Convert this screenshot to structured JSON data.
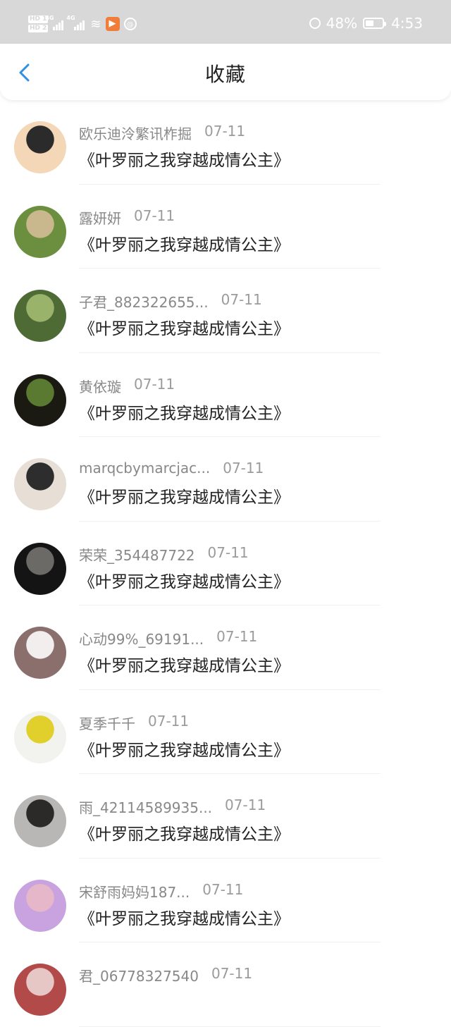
{
  "status": {
    "hd1": "HD 1",
    "hd2": "HD 2",
    "sig1": "4G",
    "sig2": "4G",
    "battery": "48%",
    "time": "4:53",
    "icons": [
      "hd-icon",
      "signal-icon",
      "wifi-icon",
      "app-icon",
      "alarm-icon",
      "battery-icon"
    ]
  },
  "nav": {
    "title": "收藏",
    "back_icon": "chevron-left-icon"
  },
  "items": [
    {
      "name": "欧乐迪泠繁讯柞掘",
      "date": "07-11",
      "content": "《叶罗丽之我穿越成情公主》",
      "avatar_colors": [
        "#f3d7b7",
        "#2b2b2b"
      ]
    },
    {
      "name": "露妍妍",
      "date": "07-11",
      "content": "《叶罗丽之我穿越成情公主》",
      "avatar_colors": [
        "#6c8f3f",
        "#c9b88d"
      ]
    },
    {
      "name": "子君_882322655...",
      "date": "07-11",
      "content": "《叶罗丽之我穿越成情公主》",
      "avatar_colors": [
        "#4f6b35",
        "#9ab36a"
      ]
    },
    {
      "name": "黄依璇",
      "date": "07-11",
      "content": "《叶罗丽之我穿越成情公主》",
      "avatar_colors": [
        "#1a1a12",
        "#5b7a31"
      ]
    },
    {
      "name": "marqcbymarcjac...",
      "date": "07-11",
      "content": "《叶罗丽之我穿越成情公主》",
      "avatar_colors": [
        "#e7ded5",
        "#2d2d2d"
      ]
    },
    {
      "name": "荣荣_354487722",
      "date": "07-11",
      "content": "《叶罗丽之我穿越成情公主》",
      "avatar_colors": [
        "#141414",
        "#6b6a66"
      ]
    },
    {
      "name": "心动99%_69191...",
      "date": "07-11",
      "content": "《叶罗丽之我穿越成情公主》",
      "avatar_colors": [
        "#8a6f6c",
        "#f2eeee"
      ]
    },
    {
      "name": "夏季千千",
      "date": "07-11",
      "content": "《叶罗丽之我穿越成情公主》",
      "avatar_colors": [
        "#f2f2ee",
        "#e1cf2c"
      ]
    },
    {
      "name": "雨_42114589935...",
      "date": "07-11",
      "content": "《叶罗丽之我穿越成情公主》",
      "avatar_colors": [
        "#b9b7b5",
        "#2c2a28"
      ]
    },
    {
      "name": "宋舒雨妈妈187...",
      "date": "07-11",
      "content": "《叶罗丽之我穿越成情公主》",
      "avatar_colors": [
        "#c9a3e0",
        "#e5b7c9"
      ]
    },
    {
      "name": "君_06778327540",
      "date": "07-11",
      "content": "",
      "avatar_colors": [
        "#b24a4a",
        "#e7c6c6"
      ]
    }
  ]
}
